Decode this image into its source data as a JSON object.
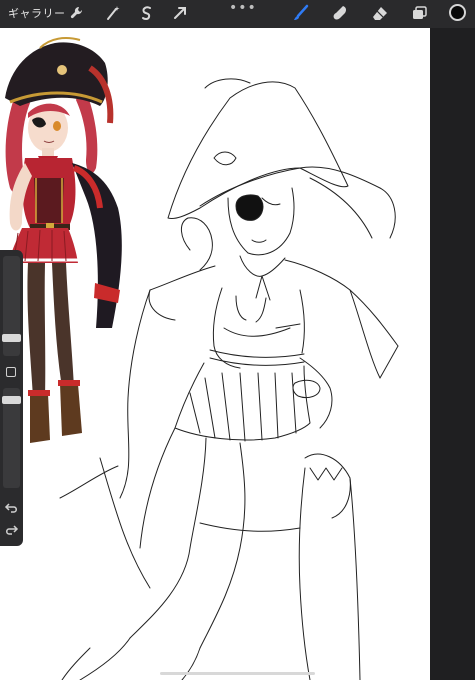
{
  "toolbar": {
    "gallery_label": "ギャラリー",
    "more_label": "•••",
    "left_icons": [
      "wrench-icon",
      "magic-wand-icon",
      "selection-icon",
      "transform-arrow-icon"
    ],
    "right_icons": [
      "brush-icon",
      "smudge-icon",
      "eraser-icon",
      "layers-icon"
    ],
    "active_tool": "brush",
    "active_color": "#0a0a0a",
    "accent": "#2f7bf5"
  },
  "sidebar": {
    "brush_size_level": 0.3,
    "opacity_level": 0.35,
    "buttons": [
      "modify-button",
      "undo-button",
      "redo-button"
    ]
  }
}
